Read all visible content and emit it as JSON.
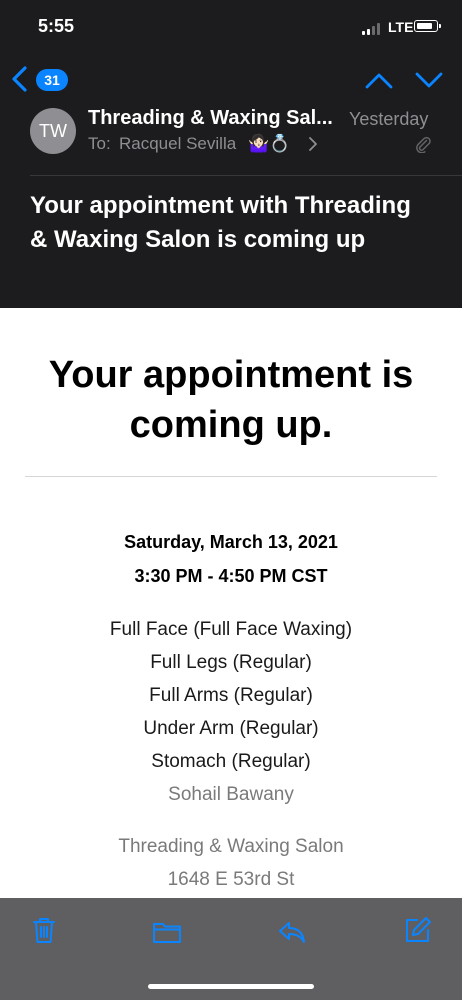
{
  "status_bar": {
    "time": "5:55",
    "network": "LTE",
    "signal_bars": 2,
    "battery_level": 0.85
  },
  "nav": {
    "unread_count": "31"
  },
  "message": {
    "avatar_initials": "TW",
    "sender": "Threading & Waxing Sal...",
    "date": "Yesterday",
    "to_label": "To:",
    "to_name": "Racquel Sevilla",
    "to_emoji": "🤷🏻‍♀️💍",
    "subject": "Your appointment with Threading & Waxing Salon is coming up"
  },
  "body": {
    "heading": "Your appointment is coming up.",
    "date": "Saturday, March 13, 2021",
    "time": "3:30 PM - 4:50 PM CST",
    "services": [
      "Full Face (Full Face Waxing)",
      "Full Legs (Regular)",
      "Full Arms (Regular)",
      "Under Arm (Regular)",
      "Stomach (Regular)"
    ],
    "staff": "Sohail Bawany",
    "salon_name": "Threading & Waxing Salon",
    "salon_street": "1648 E 53rd St"
  },
  "toolbar": {
    "icons": [
      "trash-icon",
      "folder-icon",
      "reply-icon",
      "compose-icon"
    ]
  },
  "colors": {
    "accent": "#0a84ff",
    "dark_bg": "#1c1c1e",
    "toolbar_bg": "#5f5f62",
    "secondary_text": "#8e8e93"
  }
}
